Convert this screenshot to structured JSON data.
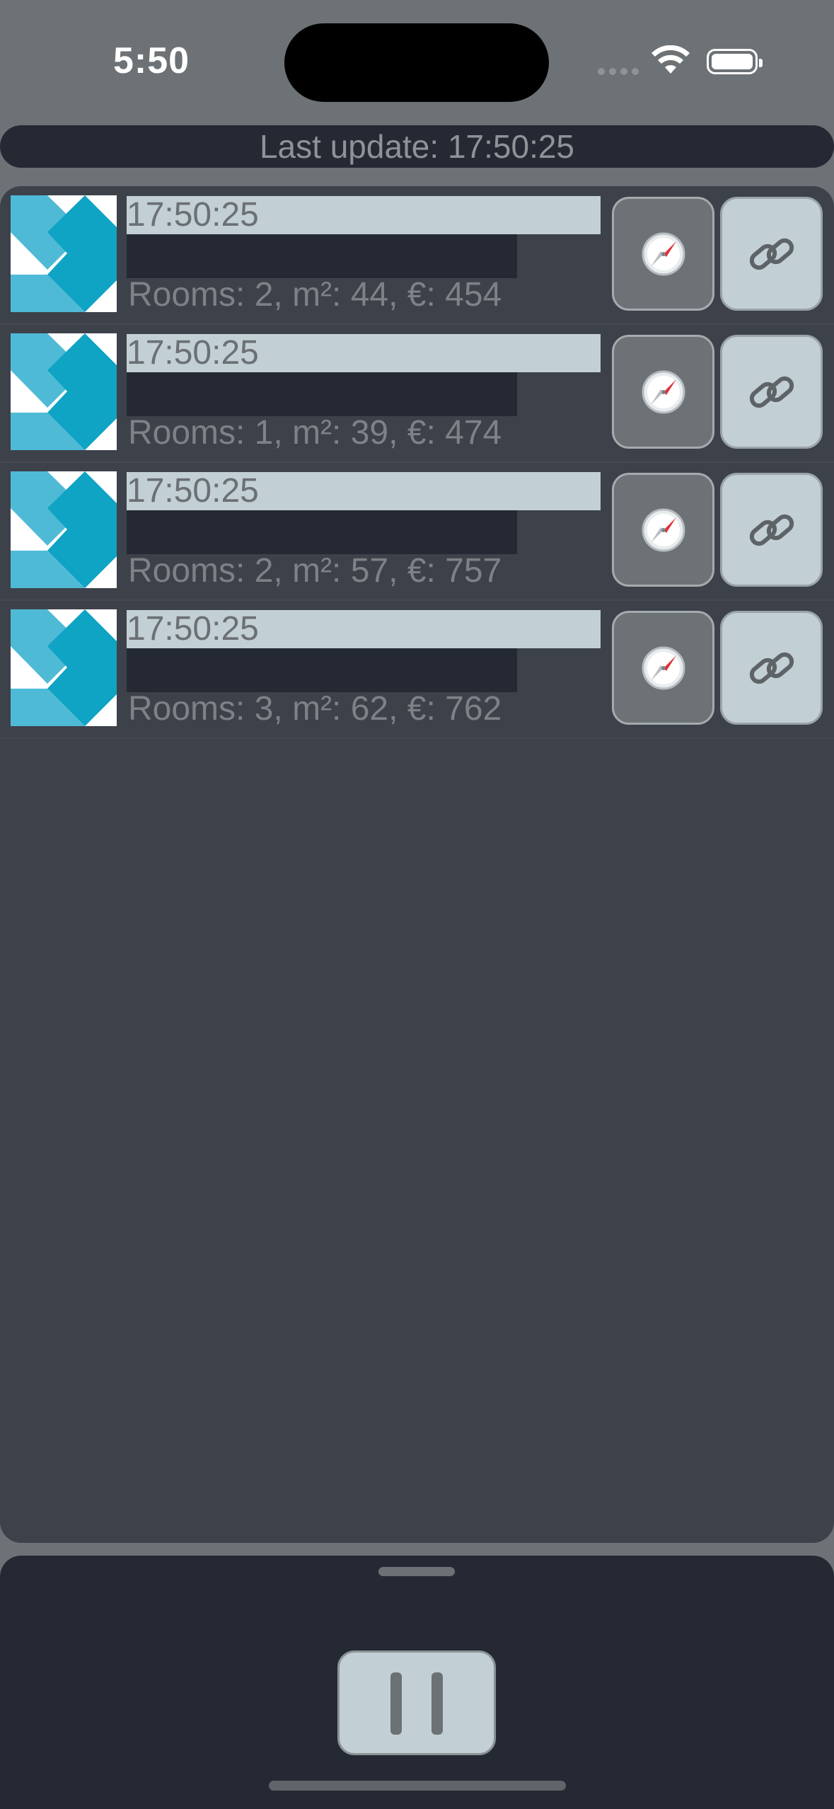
{
  "status_bar": {
    "time": "5:50",
    "icons": [
      "cellular-signal-icon",
      "wifi-icon",
      "battery-icon"
    ]
  },
  "header": {
    "last_update": "Last update: 17:50:25"
  },
  "listings": [
    {
      "time": "17:50:25",
      "details": "Rooms: 2, m²: 44, €: 454"
    },
    {
      "time": "17:50:25",
      "details": "Rooms: 1, m²: 39, €: 474"
    },
    {
      "time": "17:50:25",
      "details": "Rooms: 2, m²: 57, €: 757"
    },
    {
      "time": "17:50:25",
      "details": "Rooms: 3, m²: 62, €: 762"
    }
  ],
  "row_buttons": {
    "open_icon": "safari-compass-icon",
    "link_icon": "link-icon"
  },
  "controls": {
    "pause_icon": "pause-icon"
  },
  "colors": {
    "background": "#6c7275",
    "panel": "#3d414a",
    "dark": "#252934",
    "accent_light": "#c2cfd4",
    "logo_teal": "#0fa3c4",
    "logo_light": "#4fbad6"
  }
}
